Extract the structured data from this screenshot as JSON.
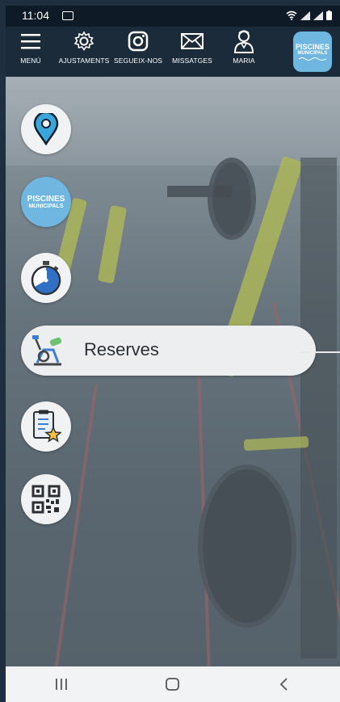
{
  "status_bar": {
    "time": "11:04"
  },
  "toolbar": {
    "items": [
      {
        "label": "MENÚ",
        "icon": "hamburger-icon"
      },
      {
        "label": "AJUSTAMENTS",
        "icon": "gear-icon"
      },
      {
        "label": "SEGUEIX-NOS",
        "icon": "instagram-icon"
      },
      {
        "label": "MISSATGES",
        "icon": "envelope-icon"
      },
      {
        "label": "MARIA",
        "icon": "user-icon"
      }
    ],
    "logo": {
      "line1": "PISCINES",
      "line2": "MUNICIPALS"
    }
  },
  "side_menu": {
    "items": [
      {
        "icon": "location-pin-icon"
      },
      {
        "icon": "piscines-logo-icon",
        "line1": "PISCINES",
        "line2": "MUNICIPALS"
      },
      {
        "icon": "stopwatch-icon"
      },
      {
        "icon": "exercise-bike-icon",
        "label": "Reserves",
        "expanded": true
      },
      {
        "icon": "checklist-star-icon"
      },
      {
        "icon": "qr-code-icon"
      }
    ]
  },
  "nav_bar": {
    "items": [
      "recent-apps",
      "home",
      "back"
    ]
  },
  "colors": {
    "pin_blue": "#3aa6dc",
    "logo_blue": "#6fb7e0",
    "toolbar": "#1b2b3a"
  }
}
